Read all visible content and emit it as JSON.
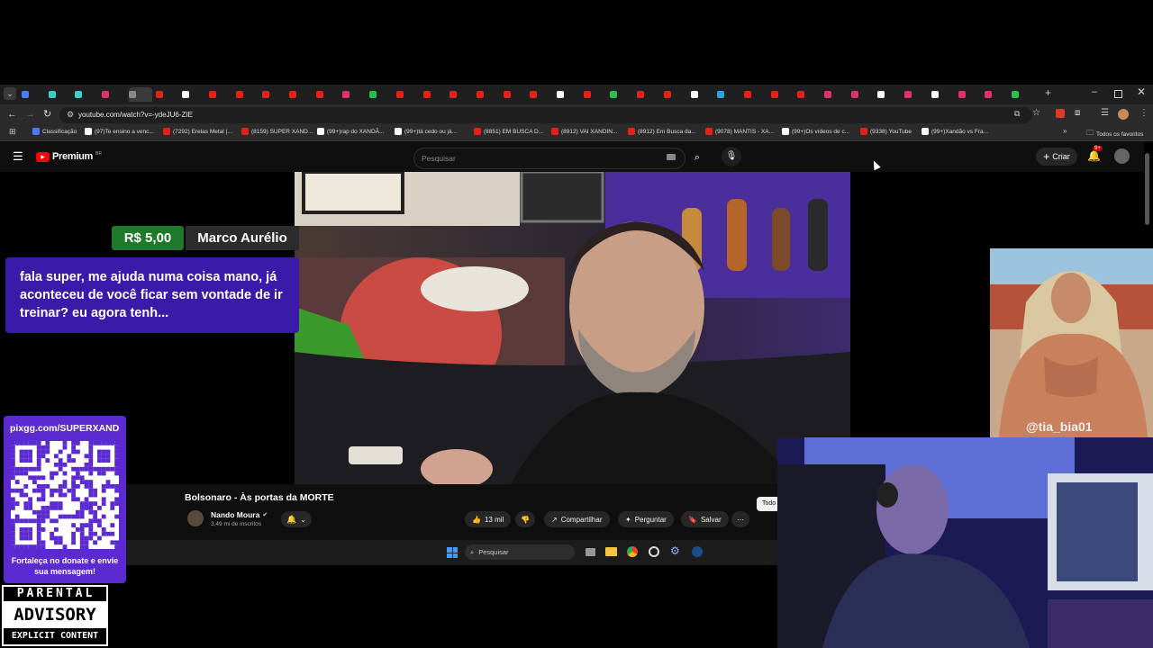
{
  "browser": {
    "url": "youtube.com/watch?v=-ydeJU6-ZIE",
    "bookmarks": [
      {
        "label": "Classificação",
        "color": "#4a7cff"
      },
      {
        "label": "(97)Te ensino a venc...",
        "color": "#ffffff"
      },
      {
        "label": "(7292) Erelas Metal |...",
        "color": "#e62117"
      },
      {
        "label": "(8159) SUPER XAND...",
        "color": "#e62117"
      },
      {
        "label": "(99+)rap do XANDÃ...",
        "color": "#ffffff"
      },
      {
        "label": "(99+)tá cedo ou já...",
        "color": "#ffffff"
      },
      {
        "label": "(8851) EM BUSCA D...",
        "color": "#e62117"
      },
      {
        "label": "(8912) VAI XANDIN...",
        "color": "#e62117"
      },
      {
        "label": "(8912) Em Busca da...",
        "color": "#e62117"
      },
      {
        "label": "(9078) MANTIS - XA...",
        "color": "#e62117"
      },
      {
        "label": "(99+)Os vídeos de c...",
        "color": "#ffffff"
      },
      {
        "label": "(9338) YouTube",
        "color": "#e62117"
      },
      {
        "label": "(99+)Xandão vs Fra...",
        "color": "#ffffff"
      }
    ],
    "all_bookmarks": "Todos os favoritos"
  },
  "youtube": {
    "logo": "Premium",
    "region": "BR",
    "search_placeholder": "Pesquisar",
    "create_label": "Criar",
    "notification_badge": "9+",
    "video_title": "Bolsonaro - Às portas da MORTE",
    "channel": "Nando Moura",
    "subscribers": "3,49 mi de inscritos",
    "likes": "13 mil",
    "share_label": "Compartilhar",
    "ask_label": "Perguntar",
    "save_label": "Salvar",
    "tooltip": "Todo"
  },
  "taskbar": {
    "search_placeholder": "Pesquisar"
  },
  "superchat": {
    "amount": "R$ 5,00",
    "name": "Marco Aurélio",
    "message": "fala super, me ajuda numa coisa mano, já aconteceu de você ficar sem vontade de ir treinar? eu agora tenh..."
  },
  "pix": {
    "url": "pixgg.com/SUPERXAND",
    "caption": "Fortaleça no donate e envie sua mensagem!"
  },
  "advisory": {
    "line1": "PARENTAL",
    "line2": "ADVISORY",
    "line3": "EXPLICIT CONTENT"
  },
  "meme": {
    "watermark": "@tia_bia01"
  }
}
